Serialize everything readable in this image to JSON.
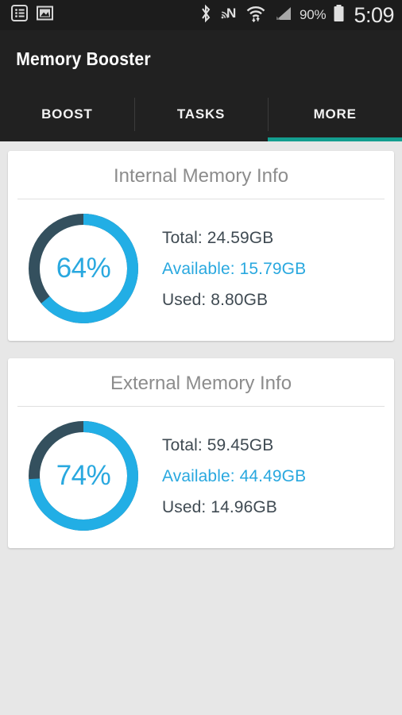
{
  "statusbar": {
    "notification_icons": [
      "agenda-list-icon",
      "image-icon"
    ],
    "system_icons": [
      "bluetooth-icon",
      "nfc-icon",
      "wifi-icon",
      "cellular-signal-icon"
    ],
    "battery_percent": "90%",
    "time": "5:09"
  },
  "actionbar": {
    "title": "Memory Booster"
  },
  "tabs": {
    "items": [
      {
        "label": "BOOST",
        "active": false
      },
      {
        "label": "TASKS",
        "active": false
      },
      {
        "label": "MORE",
        "active": true
      }
    ],
    "indicator_color": "#149e90"
  },
  "colors": {
    "accent_blue": "#22aee5",
    "track_dark": "#34505e",
    "text_dark": "#3f4a52",
    "title_gray": "#8c8c8c",
    "page_bg": "#e7e7e7"
  },
  "cards": [
    {
      "title": "Internal Memory Info",
      "percent_label": "64%",
      "percent_value": 64,
      "stats": [
        {
          "label": "Total: 24.59GB",
          "accent": false
        },
        {
          "label": "Available: 15.79GB",
          "accent": true
        },
        {
          "label": "Used: 8.80GB",
          "accent": false
        }
      ]
    },
    {
      "title": "External Memory Info",
      "percent_label": "74%",
      "percent_value": 74,
      "stats": [
        {
          "label": "Total: 59.45GB",
          "accent": false
        },
        {
          "label": "Available: 44.49GB",
          "accent": true
        },
        {
          "label": "Used: 14.96GB",
          "accent": false
        }
      ]
    }
  ],
  "chart_data": [
    {
      "type": "pie",
      "title": "Internal Memory Info",
      "categories": [
        "Available",
        "Used"
      ],
      "values": [
        15.79,
        8.8
      ],
      "unit": "GB",
      "total": 24.59,
      "percent_shown": 64,
      "donut": true,
      "colors": [
        "#22aee5",
        "#34505e"
      ],
      "legend": [
        "Total: 24.59GB",
        "Available: 15.79GB",
        "Used: 8.80GB"
      ]
    },
    {
      "type": "pie",
      "title": "External Memory Info",
      "categories": [
        "Available",
        "Used"
      ],
      "values": [
        44.49,
        14.96
      ],
      "unit": "GB",
      "total": 59.45,
      "percent_shown": 74,
      "donut": true,
      "colors": [
        "#22aee5",
        "#34505e"
      ],
      "legend": [
        "Total: 59.45GB",
        "Available: 44.49GB",
        "Used: 14.96GB"
      ]
    }
  ]
}
